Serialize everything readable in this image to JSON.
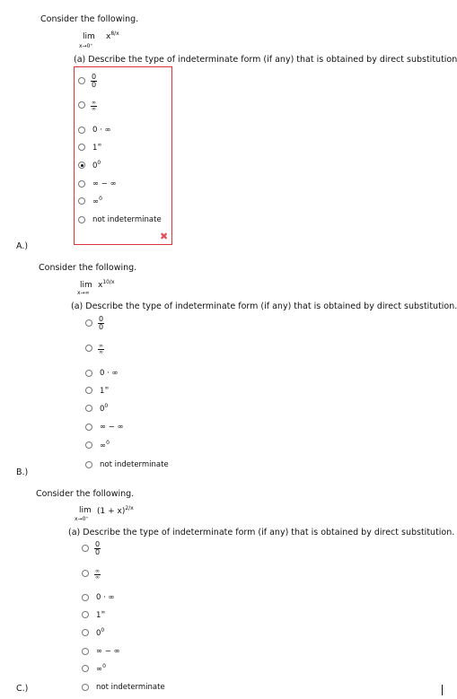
{
  "problems": [
    {
      "letter": "A.)",
      "prompt": "Consider the following.",
      "lim_word": "lim",
      "lim_sub": "x→0⁺",
      "expr_base": "x",
      "expr_exp": "8/x",
      "question": "(a) Describe the type of indeterminate form (if any) that is obtained by direct substitution.",
      "selected": 4,
      "result": "incorrect"
    },
    {
      "letter": "B.)",
      "prompt": "Consider the following.",
      "lim_word": "lim",
      "lim_sub": "x→∞",
      "expr_base": "x",
      "expr_exp": "10/x",
      "question": "(a) Describe the type of indeterminate form (if any) that is obtained by direct substitution.",
      "selected": null
    },
    {
      "letter": "C.)",
      "prompt": "Consider the following.",
      "lim_word": "lim",
      "lim_sub": "x→0⁺",
      "expr_base": "(1 + x)",
      "expr_exp": "2/x",
      "question": "(a) Describe the type of indeterminate form (if any) that is obtained by direct substitution.",
      "selected": null
    }
  ],
  "options": {
    "zero_over_zero": {
      "num": "0",
      "den": "0"
    },
    "inf_over_inf": {
      "num": "∞",
      "den": "∞"
    },
    "zero_times_inf": "0 · ∞",
    "one_pow_inf": {
      "base": "1",
      "exp": "∞"
    },
    "zero_pow_zero": {
      "base": "0",
      "exp": "0"
    },
    "inf_minus_inf": "∞ − ∞",
    "inf_pow_zero": {
      "base": "∞",
      "exp": "0"
    },
    "not_indeterminate": "not indeterminate"
  },
  "feedback_icon": "x-mark-icon",
  "colors": {
    "incorrect": "#d7343c"
  }
}
